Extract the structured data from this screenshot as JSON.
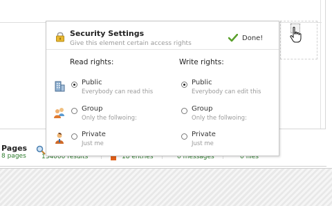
{
  "popup": {
    "title": "Security Settings",
    "subtitle": "Give this element certain access rights",
    "done_label": "Done!",
    "read": {
      "heading": "Read rights:",
      "options": [
        {
          "label": "Public",
          "desc": "Everybody can read this",
          "selected": true
        },
        {
          "label": "Group",
          "desc": "Only the follwoing:",
          "selected": false
        },
        {
          "label": "Private",
          "desc": "Just me",
          "selected": false
        }
      ]
    },
    "write": {
      "heading": "Write rights:",
      "options": [
        {
          "label": "Public",
          "desc": "Everybody can edit this",
          "selected": true
        },
        {
          "label": "Group",
          "desc": "Only the follwoing:",
          "selected": false
        },
        {
          "label": "Private",
          "desc": "Just me",
          "selected": false
        }
      ]
    }
  },
  "stats": {
    "pages_title": "Pages",
    "pages_value": "8 pages",
    "results_value": "134000 results",
    "entries_value": "18 entries",
    "messages_value": "0 messages",
    "files_value": "0 files"
  },
  "icons": {
    "lock": "lock-icon",
    "done": "checkmark-icon",
    "public": "building-icon",
    "group": "group-icon",
    "private": "user-icon",
    "cursor": "hand-cursor-icon"
  },
  "colors": {
    "check_green": "#5aa02c",
    "stat_value_green": "#2a7a2a"
  }
}
